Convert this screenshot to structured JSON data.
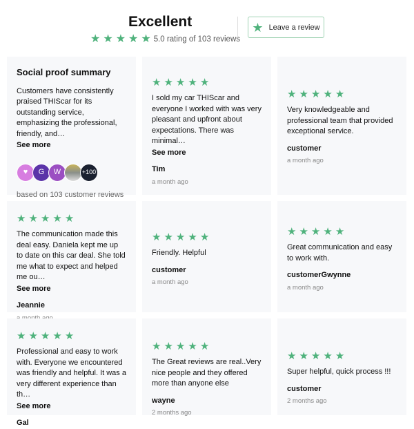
{
  "header": {
    "title": "Excellent",
    "rating_text": "5.0 rating of 103 reviews",
    "leave_review": "Leave a review",
    "stars": 5
  },
  "accent": "#4fb27c",
  "summary": {
    "title": "Social proof summary",
    "text": "Customers have consistently praised THIScar for its outstanding service, emphasizing the professional, friendly, and…",
    "see_more": "See more",
    "avatars": [
      "♥",
      "G",
      "W",
      "",
      "+100"
    ],
    "based_on": "based on 103 customer reviews"
  },
  "reviews": [
    {
      "text": "I sold my car THIScar and everyone I worked with was very pleasant and upfront about expectations. There was minimal…",
      "see_more": "See more",
      "name": "Tim",
      "time": "a month ago"
    },
    {
      "text": "Very knowledgeable and professional team that provided exceptional service.",
      "name": "customer",
      "time": "a month ago"
    },
    {
      "text": "The communication made this deal easy.  Daniela kept me up to date on this car deal.  She told me what to expect and helped me ou…",
      "see_more": "See more",
      "name": "Jeannie",
      "time": "a month ago"
    },
    {
      "text": "Friendly. Helpful",
      "name": "customer",
      "time": "a month ago"
    },
    {
      "text": "Great communication and easy to work with.",
      "name": "customerGwynne",
      "time": "a month ago"
    },
    {
      "text": "Professional and easy to work with. Everyone we encountered was friendly and helpful. It was a very different experience than th…",
      "see_more": "See more",
      "name": "Gal",
      "time": ""
    },
    {
      "text": "The Great reviews are real..Very nice people and they offered more than anyone else",
      "name": "wayne",
      "time": "2 months ago"
    },
    {
      "text": "Super helpful, quick process !!!",
      "name": "customer",
      "time": "2 months ago"
    }
  ]
}
